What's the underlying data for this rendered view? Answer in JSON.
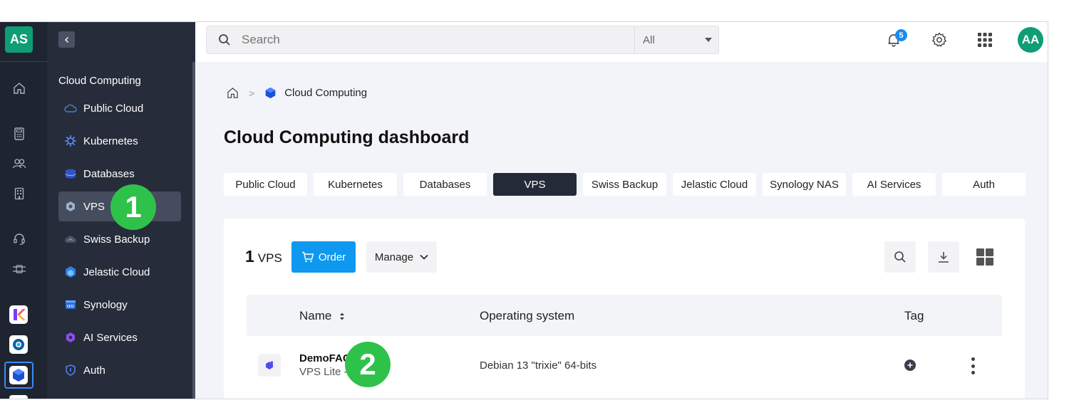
{
  "rail": {
    "account_initials": "AS",
    "icons": [
      "home-icon",
      "calculator-icon",
      "users-icon",
      "building-icon",
      "support-icon",
      "network-icon"
    ],
    "apps": [
      "kchat-app-icon",
      "kdrive-app-icon",
      "cloud-computing-app-icon"
    ]
  },
  "sidebar": {
    "section_title": "Cloud Computing",
    "items": [
      {
        "label": "Public Cloud",
        "icon": "cloud-icon"
      },
      {
        "label": "Kubernetes",
        "icon": "kubernetes-icon"
      },
      {
        "label": "Databases",
        "icon": "database-icon"
      },
      {
        "label": "VPS",
        "icon": "vps-icon"
      },
      {
        "label": "Swiss Backup",
        "icon": "backup-cloud-icon"
      },
      {
        "label": "Jelastic Cloud",
        "icon": "jelastic-icon"
      },
      {
        "label": "Synology",
        "icon": "synology-icon"
      },
      {
        "label": "AI Services",
        "icon": "ai-icon"
      },
      {
        "label": "Auth",
        "icon": "shield-icon"
      }
    ]
  },
  "topbar": {
    "search_placeholder": "Search",
    "search_scope": "All",
    "notification_count": "5",
    "avatar_initials": "AA"
  },
  "breadcrumb": {
    "current": "Cloud Computing"
  },
  "page": {
    "title": "Cloud Computing dashboard"
  },
  "tabs": [
    {
      "label": "Public Cloud",
      "active": false
    },
    {
      "label": "Kubernetes",
      "active": false
    },
    {
      "label": "Databases",
      "active": false
    },
    {
      "label": "VPS",
      "active": true
    },
    {
      "label": "Swiss Backup",
      "active": false
    },
    {
      "label": "Jelastic Cloud",
      "active": false
    },
    {
      "label": "Synology NAS",
      "active": false
    },
    {
      "label": "AI Services",
      "active": false
    },
    {
      "label": "Auth",
      "active": false
    }
  ],
  "card": {
    "count": "1",
    "count_unit": "VPS",
    "order_label": "Order",
    "manage_label": "Manage"
  },
  "table": {
    "columns": [
      "Name",
      "Operating system",
      "Tag"
    ],
    "rows": [
      {
        "name": "DemoFAQ",
        "plan": "VPS Lite - 8",
        "os": "Debian 13 \"trixie\" 64-bits"
      }
    ]
  },
  "markers": [
    "1",
    "2"
  ],
  "colors": {
    "accent": "#0f98f0",
    "brand_green": "#0f9d75",
    "marker_green": "#2fc24a",
    "dark_nav": "#1f2431"
  }
}
